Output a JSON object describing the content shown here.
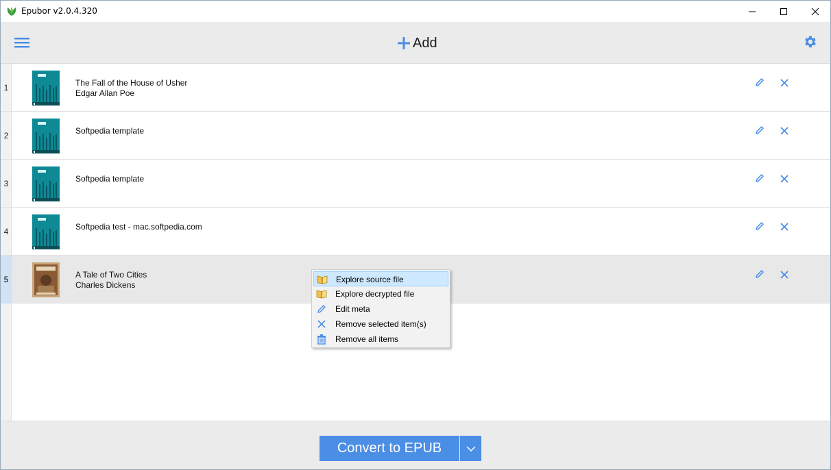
{
  "window": {
    "title": "Epubor v2.0.4.320"
  },
  "toolbar": {
    "add_label": "Add",
    "menu_icon": "hamburger-icon",
    "settings_icon": "gear-icon",
    "accent": "#4a8ee6"
  },
  "books": [
    {
      "num": "1",
      "title": "The Fall of the House of Usher",
      "author": "Edgar Allan Poe",
      "cover": "teal"
    },
    {
      "num": "2",
      "title": "Softpedia template",
      "author": "",
      "cover": "teal"
    },
    {
      "num": "3",
      "title": "Softpedia template",
      "author": "",
      "cover": "teal"
    },
    {
      "num": "4",
      "title": "Softpedia test - mac.softpedia.com",
      "author": "",
      "cover": "teal"
    },
    {
      "num": "5",
      "title": "A Tale of Two Cities",
      "author": "Charles Dickens",
      "cover": "sepia",
      "selected": true
    }
  ],
  "context_menu": {
    "items": [
      {
        "label": "Explore source file",
        "icon": "book-open-icon"
      },
      {
        "label": "Explore decrypted file",
        "icon": "book-open-icon"
      },
      {
        "label": "Edit meta",
        "icon": "pencil-icon"
      },
      {
        "label": "Remove selected item(s)",
        "icon": "close-icon"
      },
      {
        "label": "Remove all items",
        "icon": "trash-icon"
      }
    ]
  },
  "bottom": {
    "convert_label": "Convert to EPUB"
  }
}
